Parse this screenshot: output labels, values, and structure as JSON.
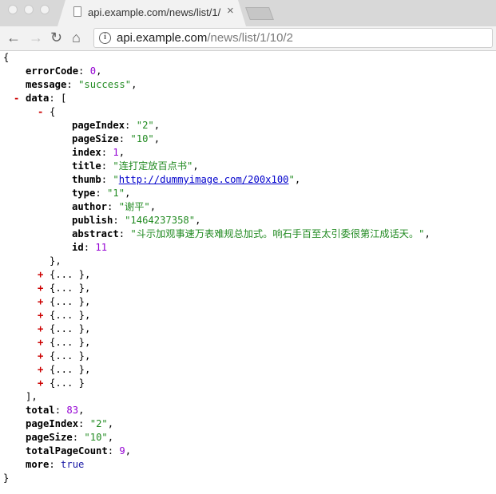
{
  "tab": {
    "title": "api.example.com/news/list/1/",
    "close_glyph": "×"
  },
  "address_bar": {
    "host": "api.example.com",
    "path": "/news/list/1/10/2"
  },
  "json": {
    "errorCode_key": "errorCode",
    "errorCode_val": "0",
    "message_key": "message",
    "message_val": "\"success\"",
    "data_key": "data",
    "item": {
      "pageIndex_key": "pageIndex",
      "pageIndex_val": "\"2\"",
      "pageSize_key": "pageSize",
      "pageSize_val": "\"10\"",
      "index_key": "index",
      "index_val": "1",
      "title_key": "title",
      "title_val": "\"连打定放百点书\"",
      "thumb_key": "thumb",
      "thumb_url": "http://dummyimage.com/200x100",
      "type_key": "type",
      "type_val": "\"1\"",
      "author_key": "author",
      "author_val": "\"谢平\"",
      "publish_key": "publish",
      "publish_val": "\"1464237358\"",
      "abstract_key": "abstract",
      "abstract_val": "\"斗示加观事速万表难规总加式。响石手百至太引委很第江成话天。\"",
      "id_key": "id",
      "id_val": "11"
    },
    "collapsed_item": "{... },",
    "collapsed_last": "{... }",
    "total_key": "total",
    "total_val": "83",
    "pageIndex_key": "pageIndex",
    "pageIndex_val": "\"2\"",
    "pageSize_key": "pageSize",
    "pageSize_val": "\"10\"",
    "totalPageCount_key": "totalPageCount",
    "totalPageCount_val": "9",
    "more_key": "more",
    "more_val": "true"
  }
}
